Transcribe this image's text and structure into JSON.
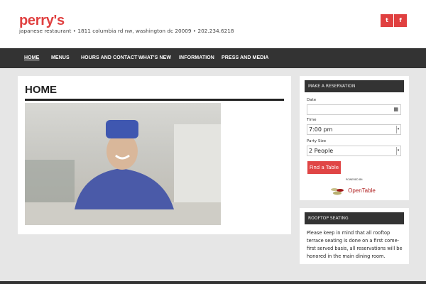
{
  "site": {
    "name": "perry's",
    "tagline": "japanese restaurant • 1811 columbia rd nw, washington dc 20009 • 202.234.6218"
  },
  "social": [
    {
      "icon": "twitter-icon",
      "glyph": "t"
    },
    {
      "icon": "facebook-icon",
      "glyph": "f"
    }
  ],
  "nav": [
    {
      "label": "HOME",
      "active": true
    },
    {
      "label": "MENUS"
    },
    {
      "label": "HOURS AND CONTACT"
    },
    {
      "label": "WHAT'S NEW"
    },
    {
      "label": "INFORMATION"
    },
    {
      "label": "PRESS AND MEDIA"
    }
  ],
  "main": {
    "title": "HOME"
  },
  "reservation": {
    "heading": "MAKE A RESERVATION",
    "date_label": "Date",
    "date_value": "",
    "time_label": "Time",
    "time_value": "7:00 pm",
    "party_label": "Party Size",
    "party_value": "2 People",
    "button": "Find a Table",
    "powered_by": "POWERED BY:",
    "brand": "OpenTable"
  },
  "rooftop": {
    "heading": "ROOFTOP SEATING",
    "text": "Please keep in mind that all rooftop terrace seating is done on a first come-first served basis, all reservations will be honored in the main dining room."
  },
  "colors": {
    "accent": "#e04040",
    "nav_bg": "#333333"
  }
}
